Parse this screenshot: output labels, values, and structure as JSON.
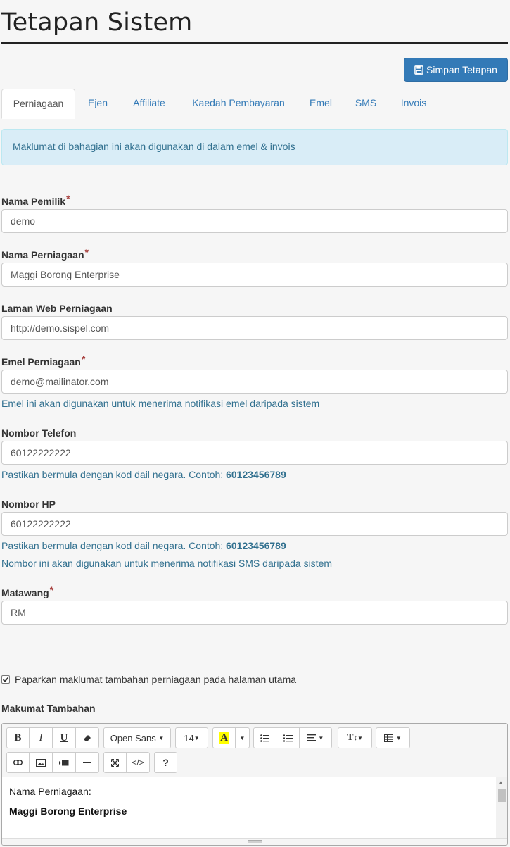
{
  "page": {
    "title": "Tetapan Sistem",
    "save_label": "Simpan Tetapan"
  },
  "tabs": [
    "Perniagaan",
    "Ejen",
    "Affiliate",
    "Kaedah Pembayaran",
    "Emel",
    "SMS",
    "Invois"
  ],
  "alert": "Maklumat di bahagian ini akan digunakan di dalam emel & invois",
  "form": {
    "owner": {
      "label": "Nama Pemilik",
      "required": "*",
      "value": "demo"
    },
    "business": {
      "label": "Nama Perniagaan",
      "required": "*",
      "value": "Maggi Borong Enterprise"
    },
    "website": {
      "label": "Laman Web Perniagaan",
      "value": "http://demo.sispel.com"
    },
    "email": {
      "label": "Emel Perniagaan",
      "required": "*",
      "value": "demo@mailinator.com",
      "help": "Emel ini akan digunakan untuk menerima notifikasi emel daripada sistem"
    },
    "phone": {
      "label": "Nombor Telefon",
      "value": "60122222222",
      "help": "Pastikan bermula dengan kod dail negara. Contoh:",
      "example": "60123456789"
    },
    "mobile": {
      "label": "Nombor HP",
      "value": "60122222222",
      "help": "Pastikan bermula dengan kod dail negara. Contoh:",
      "example": "60123456789",
      "help2": "Nombor ini akan digunakan untuk menerima notifikasi SMS daripada sistem"
    },
    "currency": {
      "label": "Matawang",
      "required": "*",
      "value": "RM"
    }
  },
  "show_extra": {
    "label": "Paparkan maklumat tambahan perniagaan pada halaman utama",
    "checked": true
  },
  "extra": {
    "label": "Makumat Tambahan",
    "toolbar": {
      "font": "Open Sans",
      "size": "14"
    },
    "content_line1": "Nama Perniagaan:",
    "content_line2": "Maggi Borong Enterprise"
  },
  "colors": {
    "primary": "#337ab7",
    "info_bg": "#d9edf7",
    "info_text": "#31708f",
    "required": "#a94442"
  }
}
